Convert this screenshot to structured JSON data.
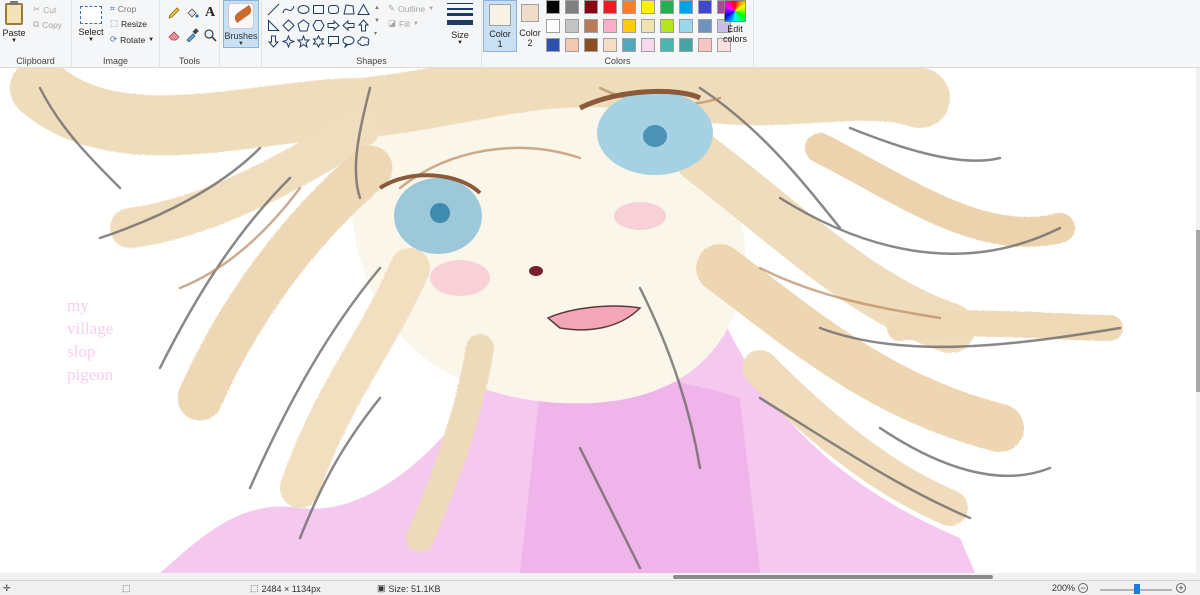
{
  "ribbon": {
    "clipboard": {
      "label": "Clipboard",
      "paste": "Paste",
      "cut": "Cut",
      "copy": "Copy"
    },
    "image": {
      "label": "Image",
      "select": "Select",
      "crop": "Crop",
      "resize": "Resize",
      "rotate": "Rotate"
    },
    "tools": {
      "label": "Tools",
      "icons": [
        "pencil-icon",
        "fill-bucket-icon",
        "text-icon",
        "eraser-icon",
        "color-picker-icon",
        "magnifier-icon"
      ],
      "text_glyph": "A"
    },
    "brushes": {
      "label": "Brushes"
    },
    "shapes": {
      "label": "Shapes",
      "outline": "Outline",
      "fill": "Fill"
    },
    "size": {
      "label": "Size"
    },
    "colors": {
      "label": "Colors",
      "color1": {
        "label": "Color",
        "num": "1",
        "value": "#f6f2e6"
      },
      "color2": {
        "label": "Color",
        "num": "2",
        "value": "#f0dccb"
      },
      "edit": "Edit colors",
      "palette": [
        "#000000",
        "#7f7f7f",
        "#880015",
        "#ed1c24",
        "#ff7f27",
        "#fff200",
        "#22b14c",
        "#00a2e8",
        "#3f48cc",
        "#a349a4",
        "#ffffff",
        "#c3c3c3",
        "#b97a57",
        "#ffaec9",
        "#ffc90e",
        "#efe4b0",
        "#b5e61d",
        "#99d9ea",
        "#7092be",
        "#c8bfe7",
        "#2f4fb0",
        "#f2c8b0",
        "#8b4d22",
        "#f5dcc4",
        "#52a7b8",
        "#f7d8ee",
        "#4bb6b0",
        "#47a4a2",
        "#f7c6c0",
        "#f8e1e0"
      ]
    }
  },
  "canvas": {
    "overlay_text": [
      "my",
      "village",
      "slop",
      "pigeon"
    ]
  },
  "status": {
    "dimensions": "2484 × 1134px",
    "size": "Size: 51.1KB",
    "zoom": "200%"
  }
}
